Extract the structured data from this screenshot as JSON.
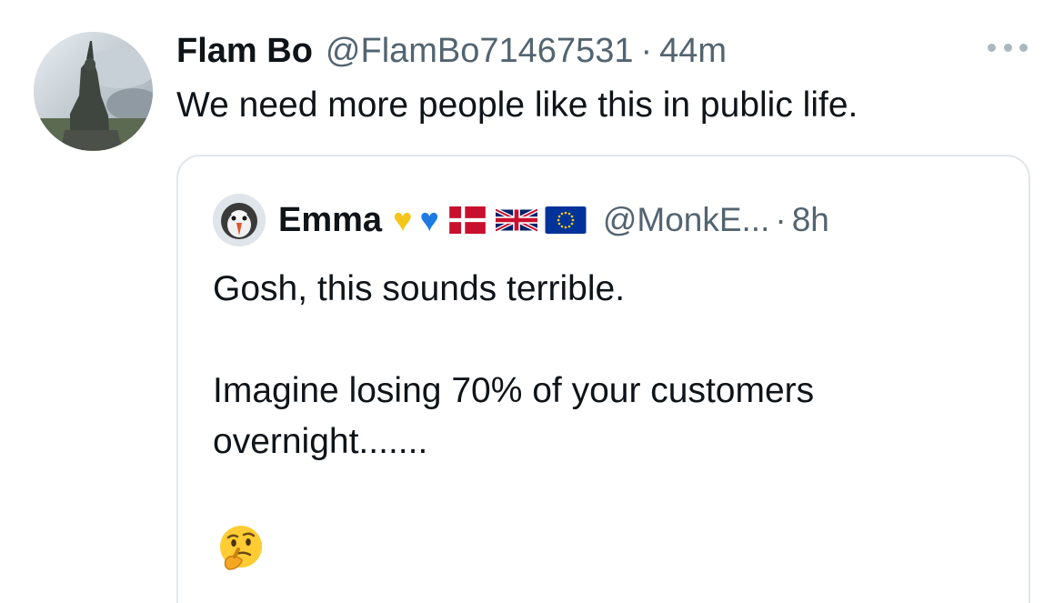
{
  "tweet": {
    "author_name": "Flam Bo",
    "author_handle": "@FlamBo71467531",
    "separator": "·",
    "time": "44m",
    "text": "We need more people like this in public life.",
    "more_icon": "more-horizontal-icon"
  },
  "quoted_tweet": {
    "author_name": "Emma",
    "badges": [
      "yellow-heart",
      "blue-heart",
      "denmark-flag",
      "uk-flag",
      "eu-flag"
    ],
    "heart_glyph": "♥",
    "author_handle": "@MonkE...",
    "separator": "·",
    "time": "8h",
    "lines": [
      "Gosh, this sounds terrible.",
      "Imagine losing 70% of your customers",
      "overnight......."
    ],
    "emoji": "thinking-face"
  },
  "colors": {
    "text": "#0f1419",
    "muted": "#536471",
    "border": "#e1e6ea"
  }
}
